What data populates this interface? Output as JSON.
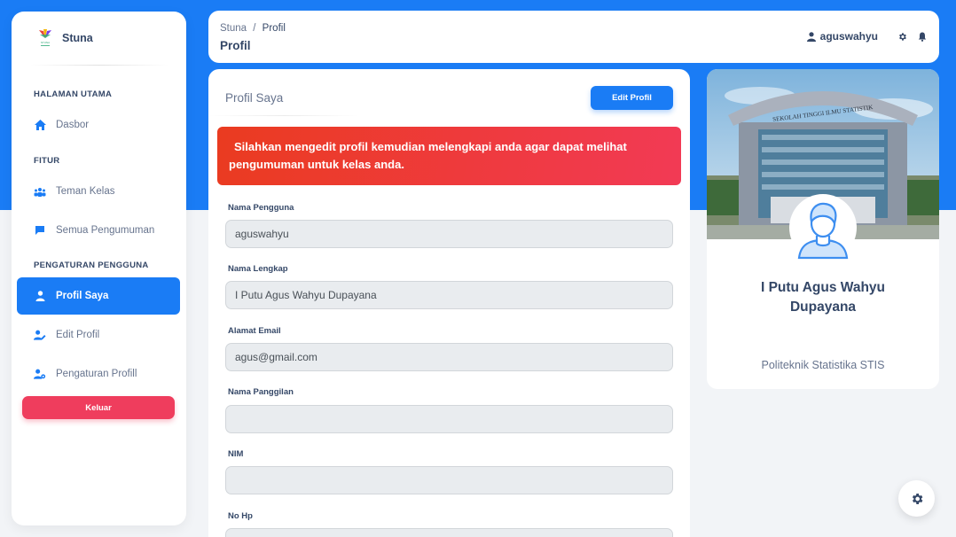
{
  "brand": {
    "name": "Stuna",
    "logo_icon": "stuna-logo-icon",
    "logo_text": "STUNA"
  },
  "sidebar": {
    "sections": [
      {
        "title": "HALAMAN UTAMA"
      },
      {
        "title": "FITUR"
      },
      {
        "title": "PENGATURAN PENGGUNA"
      }
    ],
    "items": [
      {
        "label": "Dasbor",
        "icon": "home-icon"
      },
      {
        "label": "Teman Kelas",
        "icon": "users-icon"
      },
      {
        "label": "Semua Pengumuman",
        "icon": "comment-icon"
      },
      {
        "label": "Profil Saya",
        "icon": "user-icon",
        "active": true
      },
      {
        "label": "Edit Profil",
        "icon": "user-edit-icon"
      },
      {
        "label": "Pengaturan Profill",
        "icon": "user-cog-icon"
      }
    ],
    "logout_label": "Keluar"
  },
  "header": {
    "breadcrumb_root": "Stuna",
    "breadcrumb_sep": "/",
    "breadcrumb_current": "Profil",
    "title": "Profil",
    "username": "aguswahyu"
  },
  "main": {
    "card_title": "Profil Saya",
    "edit_button": "Edit Profil",
    "alert_line1": "Silahkan mengedit profil kemudian melengkapi anda agar dapat melihat",
    "alert_line2": "pengumuman untuk kelas anda.",
    "fields": [
      {
        "label": "Nama Pengguna",
        "value": "aguswahyu"
      },
      {
        "label": "Nama Lengkap",
        "value": "I Putu Agus Wahyu Dupayana"
      },
      {
        "label": "Alamat Email",
        "value": "agus@gmail.com"
      },
      {
        "label": "Nama Panggilan",
        "value": ""
      },
      {
        "label": "NIM",
        "value": ""
      },
      {
        "label": "No Hp",
        "value": ""
      }
    ]
  },
  "profile": {
    "name": "I Putu Agus Wahyu Dupayana",
    "institution": "Politeknik Statistika STIS",
    "banner_sign": "SEKOLAH TINGGI ILMU STATISTIK"
  },
  "colors": {
    "primary": "#1a7cf5",
    "danger": "#ef3d5d",
    "alert_start": "#ea3b20",
    "alert_end": "#f23a55",
    "text_dark": "#344767",
    "text_muted": "#67748e"
  }
}
